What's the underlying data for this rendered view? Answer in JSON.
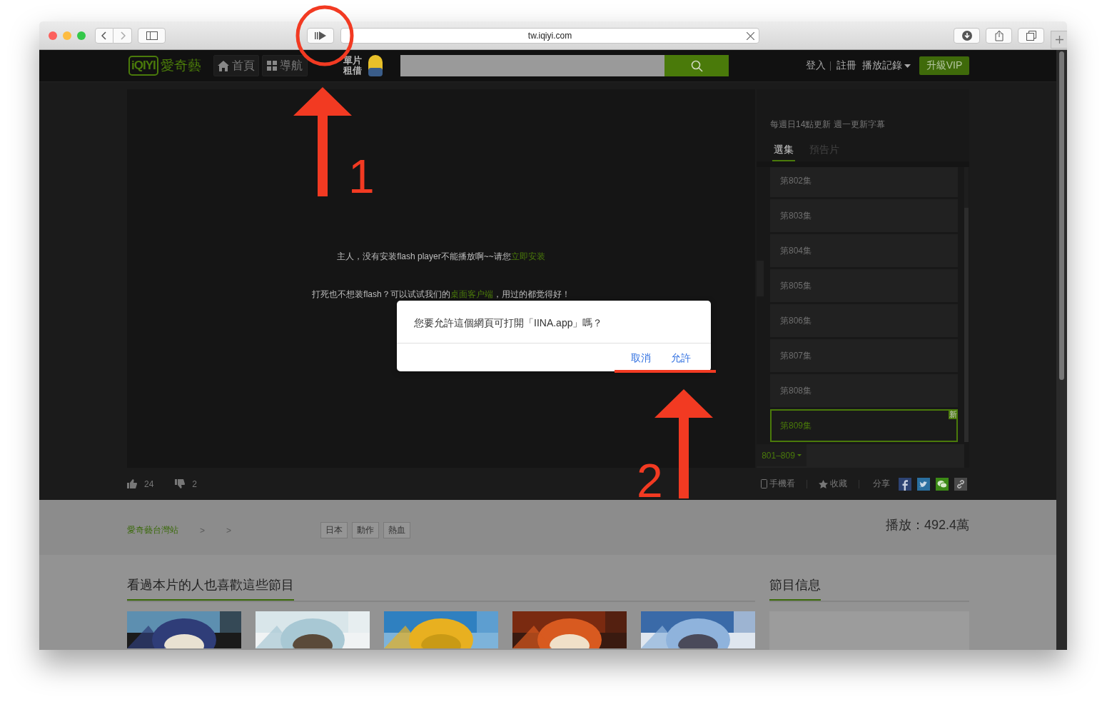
{
  "browser": {
    "url": "tw.iqiyi.com"
  },
  "nav": {
    "logo": {
      "mark": "iQIYI",
      "name": "愛奇藝"
    },
    "items": [
      {
        "label": "首頁",
        "kind": "home"
      },
      {
        "label": "導航",
        "kind": "grid"
      }
    ],
    "rental": [
      "單片",
      "租借"
    ],
    "user_links": [
      {
        "label": "登入"
      },
      {
        "label": "註冊"
      },
      {
        "label": "播放記錄"
      }
    ],
    "vip_button": "升級VIP"
  },
  "player": {
    "line_1": {
      "text": "主人，没有安装flash player不能播放啊~~请您",
      "link": "立即安装"
    },
    "line_2": {
      "text": "打死也不想装flash？可以试试我们的",
      "link": "桌面客户端",
      "tail": "，用过的都觉得好！"
    }
  },
  "sidebar": {
    "update_note": "每週日14點更新 週一更新字幕",
    "tabs": [
      {
        "label": "選集",
        "selected": true
      },
      {
        "label": "預告片",
        "selected": false
      }
    ],
    "episodes": [
      {
        "label": "第802集",
        "selected": false
      },
      {
        "label": "第803集",
        "selected": false
      },
      {
        "label": "第804集",
        "selected": false
      },
      {
        "label": "第805集",
        "selected": false
      },
      {
        "label": "第806集",
        "selected": false
      },
      {
        "label": "第807集",
        "selected": false
      },
      {
        "label": "第808集",
        "selected": false
      },
      {
        "label": "第809集",
        "selected": true,
        "badge": "新"
      }
    ],
    "range": "801–809"
  },
  "actions": {
    "likes": "24",
    "dislikes": "2",
    "mobile": "手機看",
    "favorite": "收藏",
    "share": "分享"
  },
  "info": {
    "breadcrumb": [
      "愛奇藝台灣站",
      ">",
      ">"
    ],
    "tags": [
      "日本",
      "動作",
      "熱血"
    ],
    "plays": "播放：492.4萬"
  },
  "recommend": {
    "title": "看過本片的人也喜歡這些節目"
  },
  "program_info": {
    "title": "節目信息"
  },
  "dialog": {
    "message": "您要允許這個網頁可打開「IINA.app」嗎？",
    "buttons": [
      {
        "label": "取消"
      },
      {
        "label": "允許"
      }
    ]
  },
  "annotations": [
    {
      "label": "1"
    },
    {
      "label": "2"
    }
  ]
}
